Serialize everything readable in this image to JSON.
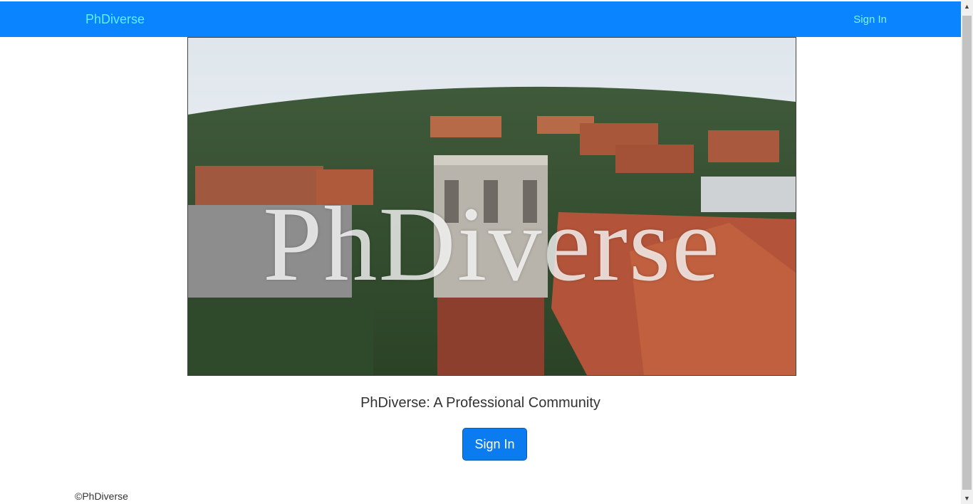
{
  "navbar": {
    "brand": "PhDiverse",
    "sign_in": "Sign In"
  },
  "hero": {
    "overlay_title": "PhDiverse",
    "image_subject": "aerial-campus-photo"
  },
  "tagline": "PhDiverse: A Professional Community",
  "cta": {
    "sign_in": "Sign In"
  },
  "footer": {
    "copyright": "©PhDiverse"
  },
  "scrollbar": {
    "up_icon": "▲",
    "down_icon": "▼"
  },
  "colors": {
    "navbar_bg": "#0a84ff",
    "brand_text": "#5ff0ff",
    "button_bg": "#0a7cf0"
  }
}
